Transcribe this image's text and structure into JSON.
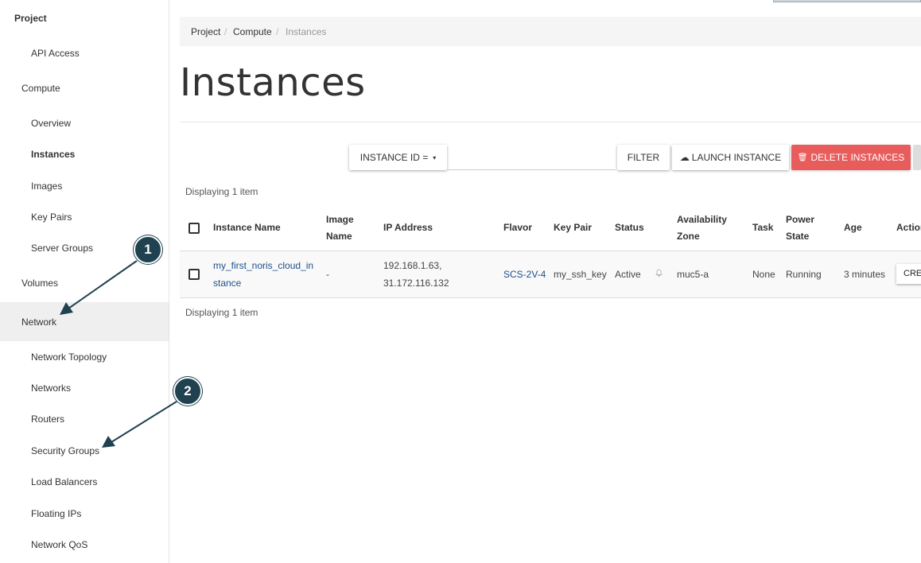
{
  "sidebar": {
    "project": "Project",
    "api_access": "API Access",
    "compute": "Compute",
    "overview": "Overview",
    "instances": "Instances",
    "images": "Images",
    "key_pairs": "Key Pairs",
    "server_groups": "Server Groups",
    "volumes": "Volumes",
    "network": "Network",
    "network_topology": "Network Topology",
    "networks": "Networks",
    "routers": "Routers",
    "security_groups": "Security Groups",
    "load_balancers": "Load Balancers",
    "floating_ips": "Floating IPs",
    "network_qos": "Network QoS"
  },
  "breadcrumb": {
    "project": "Project",
    "compute": "Compute",
    "current": "Instances",
    "sep": "/"
  },
  "page_title": "Instances",
  "toolbar": {
    "filter_field": "INSTANCE ID = ",
    "caret": "▾",
    "filter": "FILTER",
    "launch": "LAUNCH INSTANCE",
    "delete": "DELETE INSTANCES",
    "cloud_icon": "☁",
    "trash_icon": "🗑"
  },
  "display_count": "Displaying 1 item",
  "table": {
    "headers": {
      "name": "Instance Name",
      "image_1": "Image",
      "image_2": "Name",
      "ip": "IP Address",
      "flavor": "Flavor",
      "key_pair": "Key Pair",
      "status": "Status",
      "az_1": "Availability",
      "az_2": "Zone",
      "task": "Task",
      "power_1": "Power",
      "power_2": "State",
      "age": "Age",
      "actions": "Actions"
    },
    "row": {
      "name_1": "my_first_noris_cloud_in",
      "name_2": "stance",
      "image": "-",
      "ip_1": "192.168.1.63,",
      "ip_2": "31.172.116.132",
      "flavor": "SCS-2V-4",
      "key_pair": "my_ssh_key",
      "status": "Active",
      "az": "muc5-a",
      "task": "None",
      "power": "Running",
      "age": "3 minutes",
      "action": "CREATE SNAPSHOT"
    }
  },
  "annotations": {
    "one": "1",
    "two": "2"
  }
}
